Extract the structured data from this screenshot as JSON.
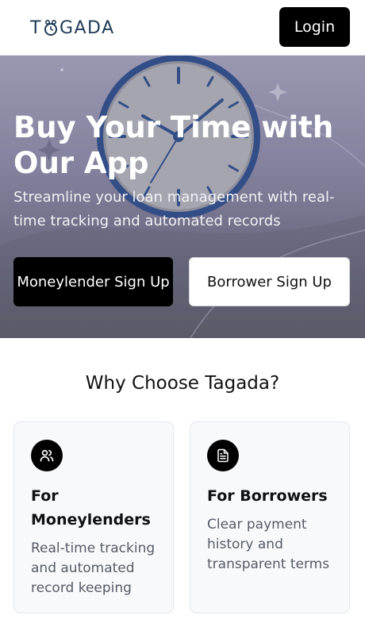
{
  "header": {
    "logo_text": "TAGADA",
    "logo_left": "T",
    "logo_right": "GADA",
    "login_label": "Login"
  },
  "hero": {
    "title": "Buy Your Time with Our App",
    "subtitle": "Streamline your loan management with real-time tracking and automated records",
    "moneylender_button": "Moneylender Sign Up",
    "borrower_button": "Borrower Sign Up"
  },
  "features": {
    "heading": "Why Choose Tagada?",
    "cards": [
      {
        "icon": "users-icon",
        "title": "For Moneylenders",
        "description": "Real-time tracking and automated record keeping"
      },
      {
        "icon": "document-icon",
        "title": "For Borrowers",
        "description": "Clear payment history and transparent terms"
      }
    ]
  },
  "colors": {
    "primary": "#000000",
    "logo": "#1f3b57",
    "clock_ring": "#2b4c8c"
  }
}
